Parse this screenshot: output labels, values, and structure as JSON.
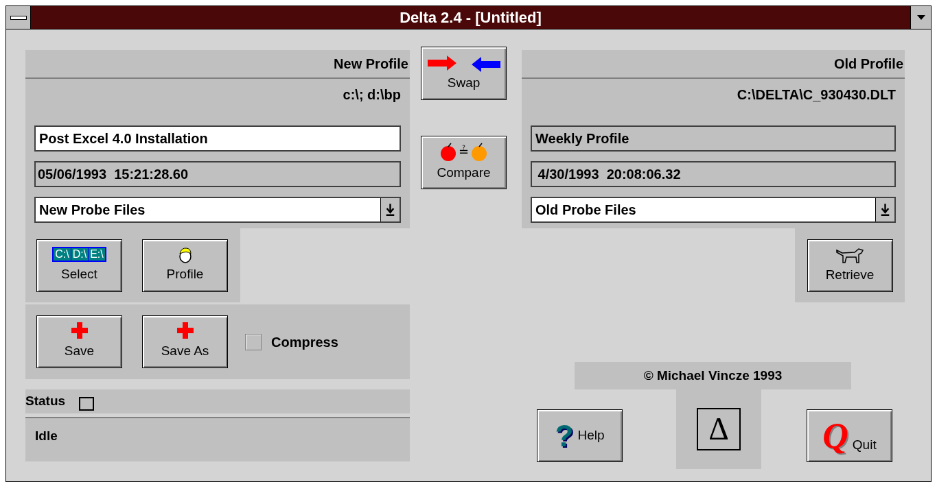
{
  "window": {
    "title": "Delta 2.4 - [Untitled]"
  },
  "new_profile": {
    "heading": "New Profile",
    "path": "c:\\; d:\\bp",
    "name": "Post Excel 4.0 Installation",
    "name_editable": true,
    "timestamp": "05/06/1993  15:21:28.60",
    "file_list": "New Probe Files"
  },
  "old_profile": {
    "heading": "Old Profile",
    "path": "C:\\DELTA\\C_930430.DLT",
    "name": "Weekly Profile",
    "name_editable": false,
    "timestamp": " 4/30/1993  20:08:06.32",
    "file_list": "Old Probe Files"
  },
  "center_buttons": [
    {
      "label": "Swap",
      "kind": "swap"
    },
    {
      "label": "Compare",
      "kind": "compare",
      "glyph": "≟"
    }
  ],
  "select_button": {
    "label": "Select",
    "drives": [
      "C:\\",
      "D:\\",
      "E:\\"
    ]
  },
  "profile_button": {
    "label": "Profile"
  },
  "save_buttons": [
    {
      "label": "Save"
    },
    {
      "label": "Save As"
    }
  ],
  "compress": {
    "label": "Compress",
    "checked": false
  },
  "status": {
    "label": "Status",
    "indicator_on": false,
    "text": "Idle"
  },
  "retrieve_button": {
    "label": "Retrieve"
  },
  "copyright": "© Michael Vincze 1993",
  "help_button": {
    "label": "Help",
    "glyph": "?"
  },
  "logo": {
    "glyph": "Δ"
  },
  "quit_button": {
    "label": "Quit",
    "glyph": "Q"
  }
}
